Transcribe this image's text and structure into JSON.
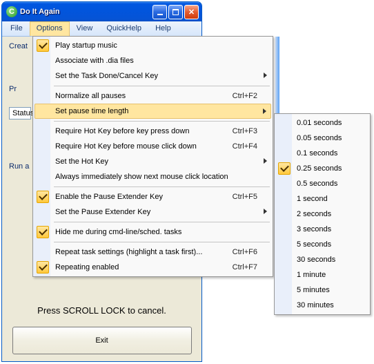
{
  "title": "Do It Again",
  "menubar": [
    "File",
    "Options",
    "View",
    "QuickHelp",
    "Help"
  ],
  "menubar_open_index": 1,
  "fragments": {
    "create": "Creat",
    "pr": "Pr",
    "status": "Status",
    "runa": "Run a"
  },
  "scroll_msg": "Press SCROLL LOCK to cancel.",
  "exit_label": "Exit",
  "options_menu": [
    {
      "type": "item",
      "label": "Play startup music",
      "checked": true
    },
    {
      "type": "item",
      "label": "Associate with .dia files"
    },
    {
      "type": "item",
      "label": "Set the Task Done/Cancel Key",
      "submenu": true
    },
    {
      "type": "sep"
    },
    {
      "type": "item",
      "label": "Normalize all pauses",
      "shortcut": "Ctrl+F2"
    },
    {
      "type": "item",
      "label": "Set pause time length",
      "submenu": true,
      "highlight": true
    },
    {
      "type": "sep"
    },
    {
      "type": "item",
      "label": "Require Hot Key before key press down",
      "shortcut": "Ctrl+F3"
    },
    {
      "type": "item",
      "label": "Require Hot Key before mouse click down",
      "shortcut": "Ctrl+F4"
    },
    {
      "type": "item",
      "label": "Set the Hot Key",
      "submenu": true
    },
    {
      "type": "item",
      "label": "Always immediately show next mouse click location"
    },
    {
      "type": "sep"
    },
    {
      "type": "item",
      "label": "Enable the Pause Extender Key",
      "checked": true,
      "shortcut": "Ctrl+F5"
    },
    {
      "type": "item",
      "label": "Set the Pause Extender Key",
      "submenu": true
    },
    {
      "type": "sep"
    },
    {
      "type": "item",
      "label": "Hide me during cmd-line/sched. tasks",
      "checked": true
    },
    {
      "type": "sep"
    },
    {
      "type": "item",
      "label": "Repeat task settings (highlight a task first)...",
      "shortcut": "Ctrl+F6"
    },
    {
      "type": "item",
      "label": "Repeating enabled",
      "checked": true,
      "shortcut": "Ctrl+F7"
    }
  ],
  "pause_submenu": [
    {
      "label": "0.01 seconds"
    },
    {
      "label": "0.05 seconds"
    },
    {
      "label": "0.1 seconds"
    },
    {
      "label": "0.25 seconds",
      "checked": true
    },
    {
      "label": "0.5 seconds"
    },
    {
      "label": "1 second"
    },
    {
      "label": "2 seconds"
    },
    {
      "label": "3 seconds"
    },
    {
      "label": "5 seconds"
    },
    {
      "label": "30 seconds"
    },
    {
      "label": "1 minute"
    },
    {
      "label": "5 minutes"
    },
    {
      "label": "30 minutes"
    }
  ]
}
